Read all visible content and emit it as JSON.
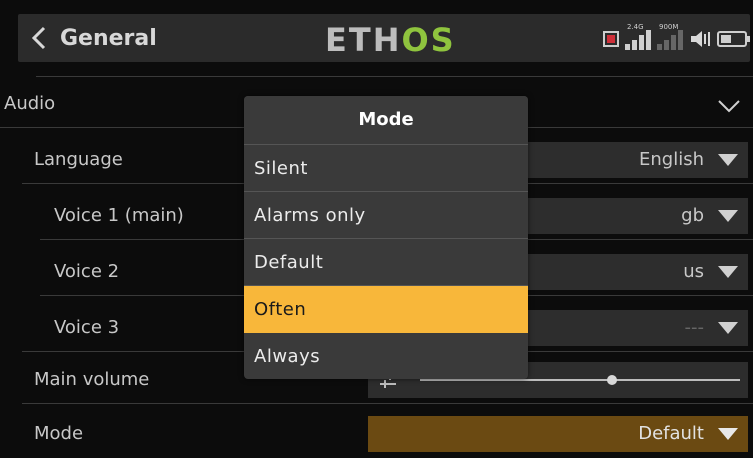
{
  "header": {
    "title": "General",
    "logo_left": "ETH",
    "logo_right": "OS",
    "signal_24_label": "2.4G",
    "signal_900_label": "900M"
  },
  "section": {
    "label": "Audio"
  },
  "rows": {
    "language": {
      "label": "Language",
      "value": "English"
    },
    "voice1": {
      "label": "Voice 1 (main)",
      "value": "gb"
    },
    "voice2": {
      "label": "Voice 2",
      "value": "us"
    },
    "voice3": {
      "label": "Voice 3",
      "value": "---"
    },
    "main_volume": {
      "label": "Main volume",
      "level": 0.6
    },
    "mode": {
      "label": "Mode",
      "value": "Default"
    }
  },
  "dialog": {
    "title": "Mode",
    "options": [
      "Silent",
      "Alarms only",
      "Default",
      "Often",
      "Always"
    ],
    "selected": "Often"
  },
  "colors": {
    "accent": "#f8b73a",
    "active_field": "#6b4a12",
    "logo_green": "#8fc43e",
    "record": "#d0303a"
  }
}
